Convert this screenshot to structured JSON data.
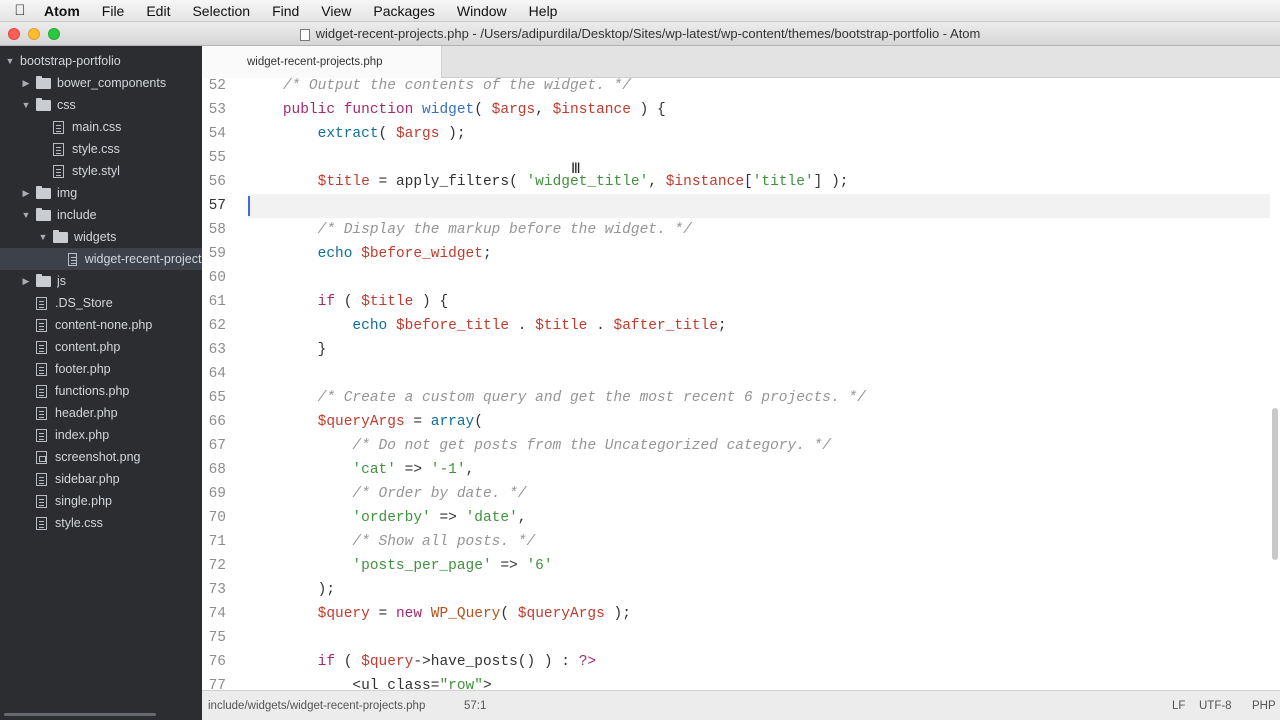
{
  "menubar": {
    "apple_icon": "apple-logo",
    "items": [
      "Atom",
      "File",
      "Edit",
      "Selection",
      "Find",
      "View",
      "Packages",
      "Window",
      "Help"
    ]
  },
  "window": {
    "title": "widget-recent-projects.php - /Users/adipurdila/Desktop/Sites/wp-latest/wp-content/themes/bootstrap-portfolio - Atom"
  },
  "tree": {
    "root": "bootstrap-portfolio",
    "items": [
      {
        "label": "bower_components",
        "type": "folder",
        "expanded": false,
        "depth": 1
      },
      {
        "label": "css",
        "type": "folder",
        "expanded": true,
        "depth": 1
      },
      {
        "label": "main.css",
        "type": "file",
        "depth": 2
      },
      {
        "label": "style.css",
        "type": "file",
        "depth": 2
      },
      {
        "label": "style.styl",
        "type": "file",
        "depth": 2
      },
      {
        "label": "img",
        "type": "folder",
        "expanded": false,
        "depth": 1
      },
      {
        "label": "include",
        "type": "folder",
        "expanded": true,
        "depth": 1
      },
      {
        "label": "widgets",
        "type": "folder",
        "expanded": true,
        "depth": 2
      },
      {
        "label": "widget-recent-projects.php",
        "type": "file",
        "depth": 3,
        "selected": true
      },
      {
        "label": "js",
        "type": "folder",
        "expanded": false,
        "depth": 1
      },
      {
        "label": ".DS_Store",
        "type": "file",
        "depth": 1
      },
      {
        "label": "content-none.php",
        "type": "file",
        "depth": 1
      },
      {
        "label": "content.php",
        "type": "file",
        "depth": 1
      },
      {
        "label": "footer.php",
        "type": "file",
        "depth": 1
      },
      {
        "label": "functions.php",
        "type": "file",
        "depth": 1
      },
      {
        "label": "header.php",
        "type": "file",
        "depth": 1
      },
      {
        "label": "index.php",
        "type": "file",
        "depth": 1
      },
      {
        "label": "screenshot.png",
        "type": "image",
        "depth": 1
      },
      {
        "label": "sidebar.php",
        "type": "file",
        "depth": 1
      },
      {
        "label": "single.php",
        "type": "file",
        "depth": 1
      },
      {
        "label": "style.css",
        "type": "file",
        "depth": 1
      }
    ]
  },
  "tab": {
    "label": "widget-recent-projects.php"
  },
  "editor": {
    "current_line": "57",
    "lines": [
      {
        "n": "52",
        "tokens": [
          [
            "plain",
            "    "
          ],
          [
            "comment",
            "/* Output the contents of the widget. */"
          ]
        ]
      },
      {
        "n": "53",
        "tokens": [
          [
            "plain",
            "    "
          ],
          [
            "keyword",
            "public function "
          ],
          [
            "func",
            "widget"
          ],
          [
            "plain",
            "( "
          ],
          [
            "var",
            "$args"
          ],
          [
            "plain",
            ", "
          ],
          [
            "var",
            "$instance"
          ],
          [
            "plain",
            " ) {"
          ]
        ]
      },
      {
        "n": "54",
        "tokens": [
          [
            "plain",
            "        "
          ],
          [
            "builtin",
            "extract"
          ],
          [
            "plain",
            "( "
          ],
          [
            "var",
            "$args"
          ],
          [
            "plain",
            " );"
          ]
        ]
      },
      {
        "n": "55",
        "tokens": []
      },
      {
        "n": "56",
        "tokens": [
          [
            "plain",
            "        "
          ],
          [
            "var",
            "$title"
          ],
          [
            "plain",
            " = apply_filters( "
          ],
          [
            "string",
            "'widget_title'"
          ],
          [
            "plain",
            ", "
          ],
          [
            "var",
            "$instance"
          ],
          [
            "plain",
            "["
          ],
          [
            "string",
            "'title'"
          ],
          [
            "plain",
            "] );"
          ]
        ]
      },
      {
        "n": "57",
        "tokens": []
      },
      {
        "n": "58",
        "tokens": [
          [
            "plain",
            "        "
          ],
          [
            "comment",
            "/* Display the markup before the widget. */"
          ]
        ]
      },
      {
        "n": "59",
        "tokens": [
          [
            "plain",
            "        "
          ],
          [
            "builtin",
            "echo "
          ],
          [
            "var",
            "$before_widget"
          ],
          [
            "plain",
            ";"
          ]
        ]
      },
      {
        "n": "60",
        "tokens": []
      },
      {
        "n": "61",
        "tokens": [
          [
            "plain",
            "        "
          ],
          [
            "keyword",
            "if"
          ],
          [
            "plain",
            " ( "
          ],
          [
            "var",
            "$title"
          ],
          [
            "plain",
            " ) {"
          ]
        ]
      },
      {
        "n": "62",
        "tokens": [
          [
            "plain",
            "            "
          ],
          [
            "builtin",
            "echo "
          ],
          [
            "var",
            "$before_title"
          ],
          [
            "plain",
            " . "
          ],
          [
            "var",
            "$title"
          ],
          [
            "plain",
            " . "
          ],
          [
            "var",
            "$after_title"
          ],
          [
            "plain",
            ";"
          ]
        ]
      },
      {
        "n": "63",
        "tokens": [
          [
            "plain",
            "        }"
          ]
        ]
      },
      {
        "n": "64",
        "tokens": []
      },
      {
        "n": "65",
        "tokens": [
          [
            "plain",
            "        "
          ],
          [
            "comment",
            "/* Create a custom query and get the most recent 6 projects. */"
          ]
        ]
      },
      {
        "n": "66",
        "tokens": [
          [
            "plain",
            "        "
          ],
          [
            "var",
            "$queryArgs"
          ],
          [
            "plain",
            " = "
          ],
          [
            "builtin",
            "array"
          ],
          [
            "plain",
            "("
          ]
        ]
      },
      {
        "n": "67",
        "tokens": [
          [
            "plain",
            "            "
          ],
          [
            "comment",
            "/* Do not get posts from the Uncategorized category. */"
          ]
        ]
      },
      {
        "n": "68",
        "tokens": [
          [
            "plain",
            "            "
          ],
          [
            "string",
            "'cat'"
          ],
          [
            "plain",
            " => "
          ],
          [
            "string",
            "'-1'"
          ],
          [
            "plain",
            ","
          ]
        ]
      },
      {
        "n": "69",
        "tokens": [
          [
            "plain",
            "            "
          ],
          [
            "comment",
            "/* Order by date. */"
          ]
        ]
      },
      {
        "n": "70",
        "tokens": [
          [
            "plain",
            "            "
          ],
          [
            "string",
            "'orderby'"
          ],
          [
            "plain",
            " => "
          ],
          [
            "string",
            "'date'"
          ],
          [
            "plain",
            ","
          ]
        ]
      },
      {
        "n": "71",
        "tokens": [
          [
            "plain",
            "            "
          ],
          [
            "comment",
            "/* Show all posts. */"
          ]
        ]
      },
      {
        "n": "72",
        "tokens": [
          [
            "plain",
            "            "
          ],
          [
            "string",
            "'posts_per_page'"
          ],
          [
            "plain",
            " => "
          ],
          [
            "string",
            "'6'"
          ]
        ]
      },
      {
        "n": "73",
        "tokens": [
          [
            "plain",
            "        );"
          ]
        ]
      },
      {
        "n": "74",
        "tokens": [
          [
            "plain",
            "        "
          ],
          [
            "var",
            "$query"
          ],
          [
            "plain",
            " = "
          ],
          [
            "keyword",
            "new "
          ],
          [
            "class",
            "WP_Query"
          ],
          [
            "plain",
            "( "
          ],
          [
            "var",
            "$queryArgs"
          ],
          [
            "plain",
            " );"
          ]
        ]
      },
      {
        "n": "75",
        "tokens": []
      },
      {
        "n": "76",
        "tokens": [
          [
            "plain",
            "        "
          ],
          [
            "keyword",
            "if"
          ],
          [
            "plain",
            " ( "
          ],
          [
            "var",
            "$query"
          ],
          [
            "plain",
            "->have_posts() ) : "
          ],
          [
            "keyword",
            "?>"
          ]
        ]
      },
      {
        "n": "77",
        "tokens": [
          [
            "plain",
            "            "
          ],
          [
            "tag",
            "<ul class="
          ],
          [
            "string",
            "\"row\""
          ],
          [
            "tag",
            ">"
          ]
        ]
      }
    ]
  },
  "status": {
    "path": "include/widgets/widget-recent-projects.php",
    "cursor": "57:1",
    "eol": "LF",
    "encoding": "UTF-8",
    "grammar": "PHP"
  },
  "colors": {
    "sidebar_bg": "#2b2d30",
    "comment": "#959595",
    "keyword": "#a4296c",
    "string": "#41913f",
    "variable": "#c23b2e",
    "function": "#346fc3"
  }
}
